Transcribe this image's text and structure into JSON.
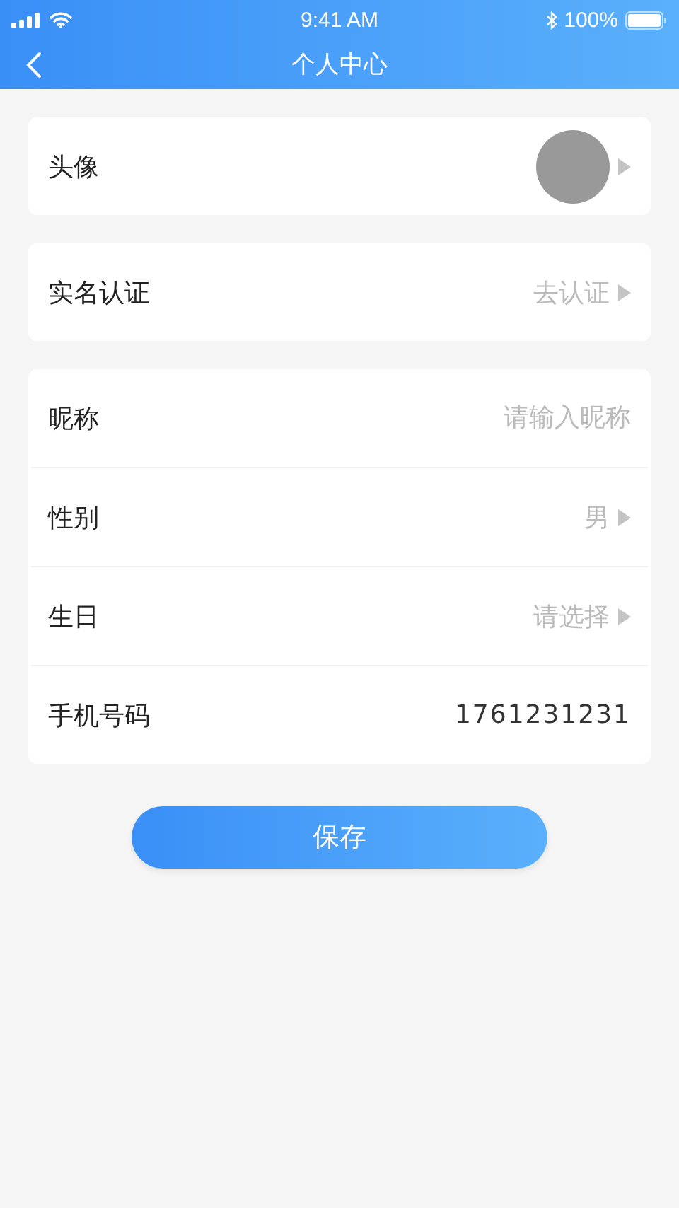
{
  "status_bar": {
    "time": "9:41 AM",
    "battery": "100%"
  },
  "nav": {
    "title": "个人中心"
  },
  "groups": [
    {
      "rows": [
        {
          "kind": "avatar",
          "label": "头像"
        }
      ]
    },
    {
      "rows": [
        {
          "kind": "link",
          "label": "实名认证",
          "value": "去认证"
        }
      ]
    },
    {
      "rows": [
        {
          "kind": "input",
          "label": "昵称",
          "placeholder": "请输入昵称"
        },
        {
          "kind": "link",
          "label": "性别",
          "value": "男"
        },
        {
          "kind": "link",
          "label": "生日",
          "value": "请选择"
        },
        {
          "kind": "text",
          "label": "手机号码",
          "value": "1761231231"
        }
      ]
    }
  ],
  "save_button": "保存"
}
